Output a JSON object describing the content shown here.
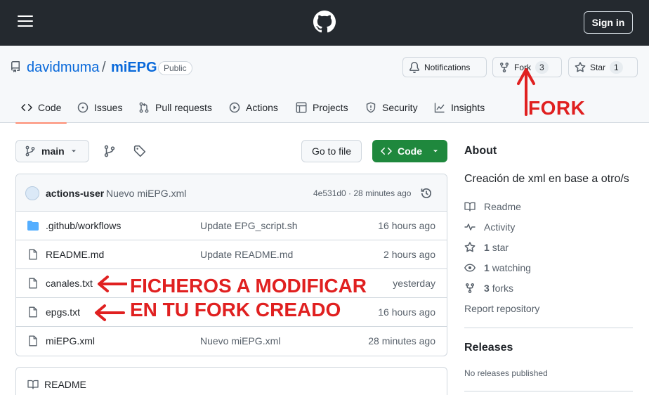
{
  "header": {
    "signin_label": "Sign in"
  },
  "repo": {
    "owner": "davidmuma",
    "separator": "/",
    "name": "miEPG",
    "visibility": "Public",
    "notifications_label": "Notifications",
    "fork_label": "Fork",
    "fork_count": "3",
    "star_label": "Star",
    "star_count": "1"
  },
  "tabs": [
    {
      "label": "Code",
      "icon": "code-icon"
    },
    {
      "label": "Issues",
      "icon": "issue-icon"
    },
    {
      "label": "Pull requests",
      "icon": "pull-request-icon"
    },
    {
      "label": "Actions",
      "icon": "play-icon"
    },
    {
      "label": "Projects",
      "icon": "table-icon"
    },
    {
      "label": "Security",
      "icon": "shield-icon"
    },
    {
      "label": "Insights",
      "icon": "graph-icon"
    }
  ],
  "annotations": {
    "fork": "FORK",
    "files_line1": "FICHEROS A MODIFICAR",
    "files_line2": "EN TU FORK CREADO",
    "color": "#e02020"
  },
  "toolbar": {
    "branch": "main",
    "goto_file": "Go to file",
    "code_button": "Code"
  },
  "commit": {
    "user": "actions-user",
    "message": "Nuevo miEPG.xml",
    "meta": "4e531d0 · 28 minutes ago"
  },
  "files": [
    {
      "type": "folder",
      "name": ".github/workflows",
      "message": "Update EPG_script.sh",
      "age": "16 hours ago"
    },
    {
      "type": "file",
      "name": "README.md",
      "message": "Update README.md",
      "age": "2 hours ago"
    },
    {
      "type": "file",
      "name": "canales.txt",
      "message": "",
      "age": "yesterday"
    },
    {
      "type": "file",
      "name": "epgs.txt",
      "message": "",
      "age": "16 hours ago"
    },
    {
      "type": "file",
      "name": "miEPG.xml",
      "message": "Nuevo miEPG.xml",
      "age": "28 minutes ago"
    }
  ],
  "readme_box": {
    "title": "README"
  },
  "about": {
    "title": "About",
    "description": "Creación de xml en base a otro/s",
    "readme": "Readme",
    "activity": "Activity",
    "stars_count": "1",
    "stars_label": "star",
    "watching_count": "1",
    "watching_label": "watching",
    "forks_count": "3",
    "forks_label": "forks",
    "report": "Report repository"
  },
  "releases": {
    "title": "Releases",
    "empty": "No releases published"
  },
  "colors": {
    "header_bg": "#24292f",
    "link": "#0969da",
    "primary_button": "#1f883d",
    "active_tab_underline": "#fd8c73",
    "folder": "#54aeff"
  }
}
